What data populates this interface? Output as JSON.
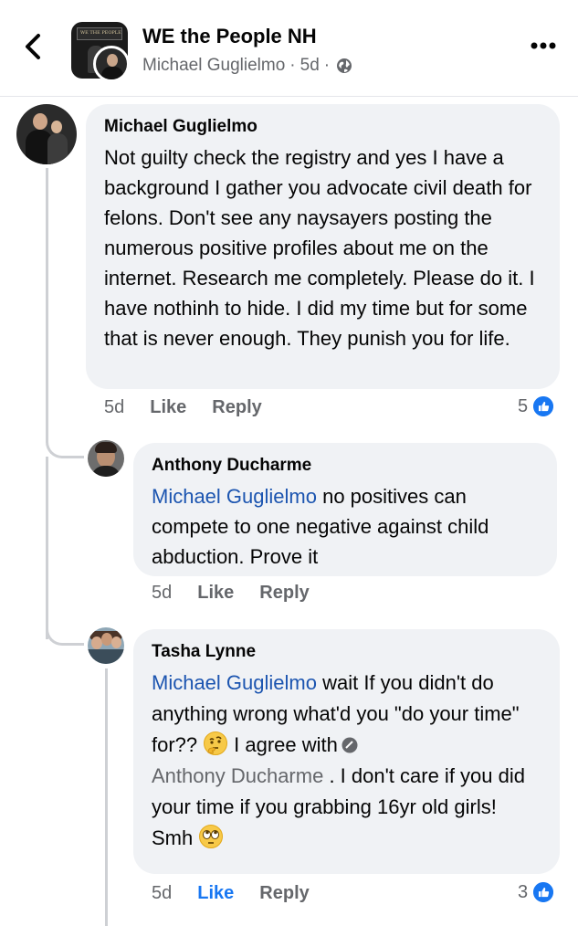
{
  "header": {
    "group_name": "WE the People NH",
    "poster_name": "Michael Guglielmo",
    "separator": "·",
    "time": "5d",
    "avatar_banner_text": "WE THE PEOPLE"
  },
  "comments": [
    {
      "author": "Michael Guglielmo",
      "text": "Not guilty check the registry and yes I have a background I gather you advocate civil death for felons. Don't see any naysayers posting the numerous positive profiles about me on the internet. Research me completely. Please do it. I have nothinh to hide. I did my time but for some that is never enough. They punish you for life.",
      "time": "5d",
      "like_label": "Like",
      "reply_label": "Reply",
      "reaction_count": "5",
      "liked": false
    },
    {
      "author": "Anthony Ducharme",
      "mention": "Michael Guglielmo",
      "text": " no positives can compete to one negative against child abduction. Prove it",
      "time": "5d",
      "like_label": "Like",
      "reply_label": "Reply",
      "liked": false
    },
    {
      "author": "Tasha Lynne",
      "mention": "Michael Guglielmo",
      "text_part1": " wait If you didn't do anything wrong what'd you \"do your time\" for??",
      "text_part2": "I agree with",
      "mention2": "Anthony Ducharme",
      "text_part3": " . I don't care if you did your time if you grabbing 16yr old girls! Smh",
      "time": "5d",
      "like_label": "Like",
      "reply_label": "Reply",
      "reaction_count": "3",
      "liked": true
    }
  ],
  "colors": {
    "bubble_bg": "#f0f2f5",
    "mention": "#1c55b0",
    "like_blue": "#1877f2",
    "meta_grey": "#65676b"
  },
  "icons": [
    "back-chevron-icon",
    "globe-icon",
    "more-dots-icon",
    "thinking-face-emoji",
    "eye-roll-emoji",
    "verified-icon",
    "like-reaction-icon"
  ]
}
